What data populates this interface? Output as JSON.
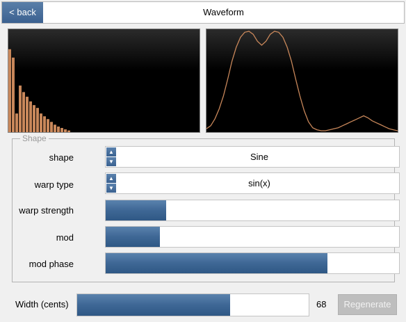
{
  "header": {
    "back_label": "< back",
    "title": "Waveform"
  },
  "spectrum": {
    "bar_color": "#c8875a",
    "bars": [
      0.89,
      0.8,
      0.2,
      0.5,
      0.43,
      0.38,
      0.33,
      0.29,
      0.26,
      0.2,
      0.17,
      0.14,
      0.11,
      0.08,
      0.06,
      0.045,
      0.03,
      0.018
    ]
  },
  "waveform": {
    "line_color": "#c8875a",
    "samples": [
      0.02,
      0.05,
      0.12,
      0.22,
      0.35,
      0.52,
      0.7,
      0.84,
      0.94,
      0.99,
      1.0,
      0.97,
      0.9,
      0.86,
      0.9,
      0.97,
      1.0,
      0.99,
      0.94,
      0.84,
      0.7,
      0.52,
      0.35,
      0.2,
      0.09,
      0.03,
      0.01,
      0.0,
      0.0,
      0.01,
      0.02,
      0.03,
      0.05,
      0.07,
      0.09,
      0.11,
      0.13,
      0.15,
      0.13,
      0.1,
      0.08,
      0.06,
      0.04,
      0.02,
      0.01,
      0.0
    ]
  },
  "shape_group": {
    "legend": "Shape",
    "shape": {
      "label": "shape",
      "value": "Sine"
    },
    "warp_type": {
      "label": "warp type",
      "value": "sin(x)"
    },
    "warp_strength": {
      "label": "warp strength",
      "level": 0.205
    },
    "mod": {
      "label": "mod",
      "level": 0.185
    },
    "mod_phase": {
      "label": "mod phase",
      "level": 0.755
    }
  },
  "width": {
    "label": "Width (cents)",
    "value": "68",
    "level": 0.66
  },
  "regenerate_label": "Regenerate",
  "accent_color": "#3e6795"
}
